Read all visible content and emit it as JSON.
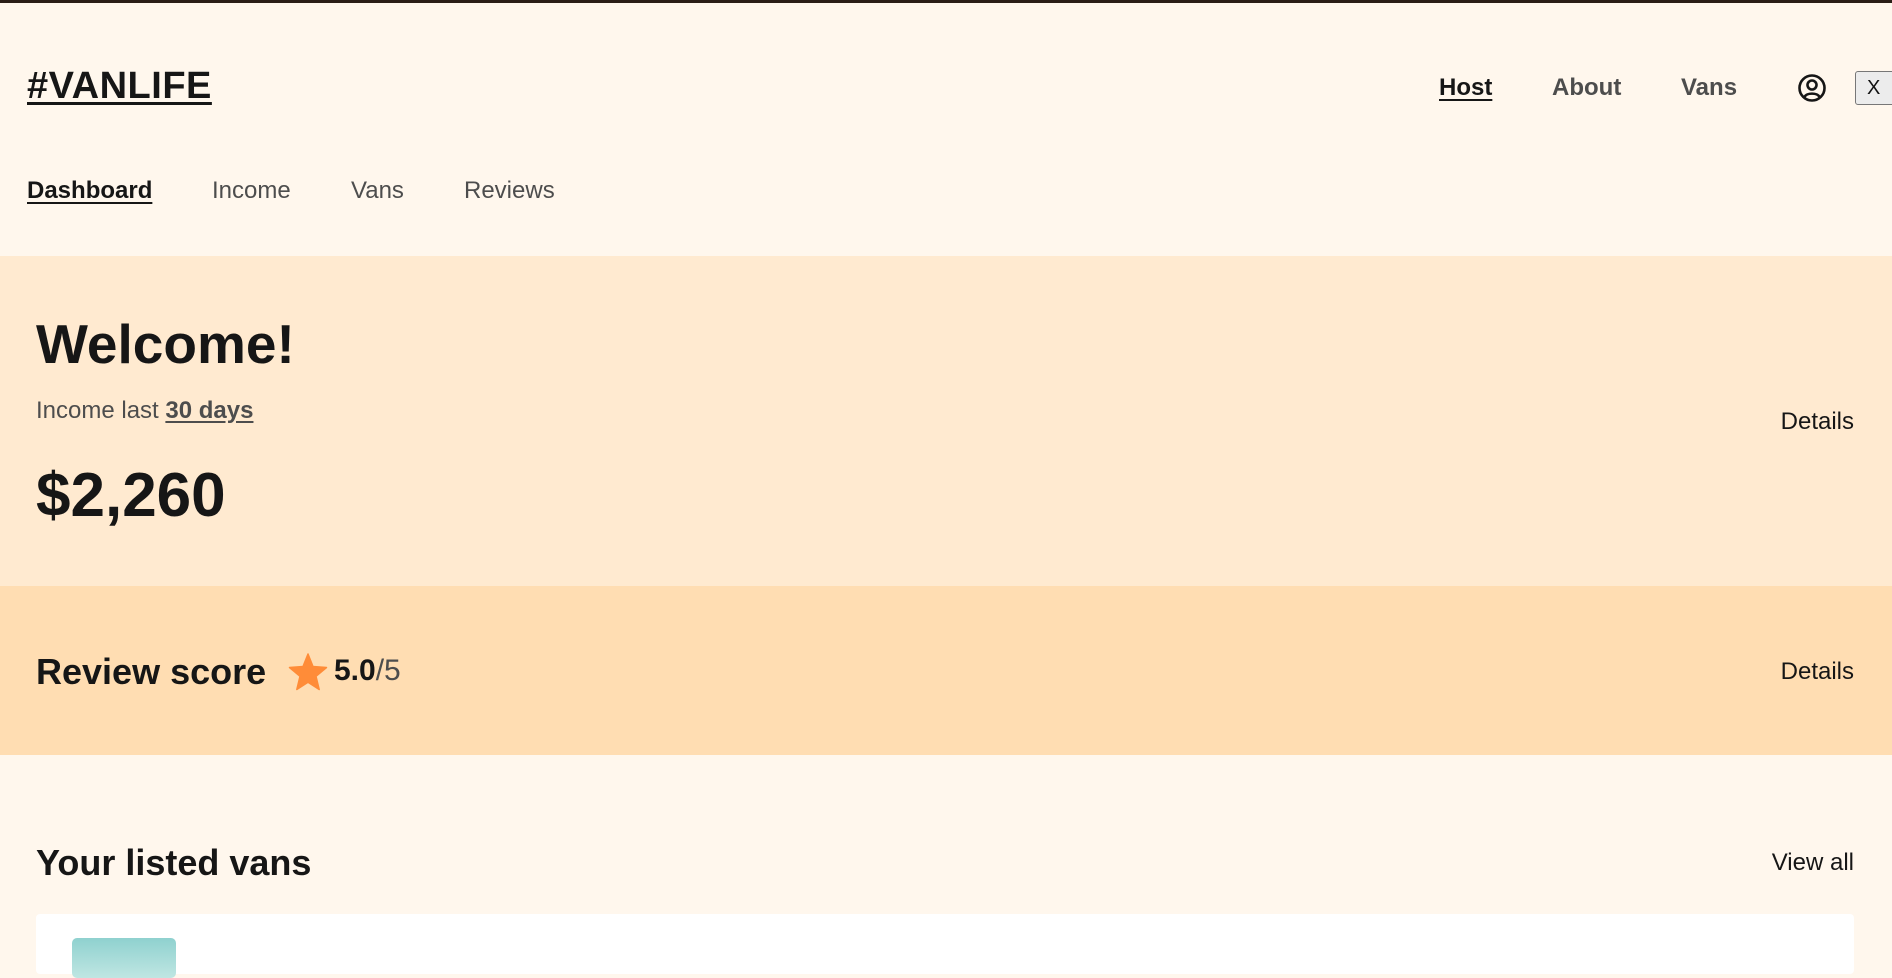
{
  "header": {
    "logo": "#VANLIFE",
    "nav": {
      "host": "Host",
      "about": "About",
      "vans": "Vans"
    },
    "close_label": "X"
  },
  "host_nav": {
    "dashboard": "Dashboard",
    "income": "Income",
    "vans": "Vans",
    "reviews": "Reviews"
  },
  "welcome": {
    "title": "Welcome!",
    "income_prefix": "Income last",
    "income_period": "30 days",
    "amount": "$2,260",
    "details": "Details"
  },
  "review": {
    "title": "Review score",
    "score": "5.0",
    "score_max": "/5",
    "details": "Details"
  },
  "listed_vans": {
    "title": "Your listed vans",
    "view_all": "View all"
  },
  "colors": {
    "page_bg": "#FFF7ED",
    "welcome_bg": "#FFEAD0",
    "review_bg": "#FFDDB2",
    "star": "#FF8C38",
    "text": "#161616",
    "muted_text": "#4D4D4D"
  }
}
